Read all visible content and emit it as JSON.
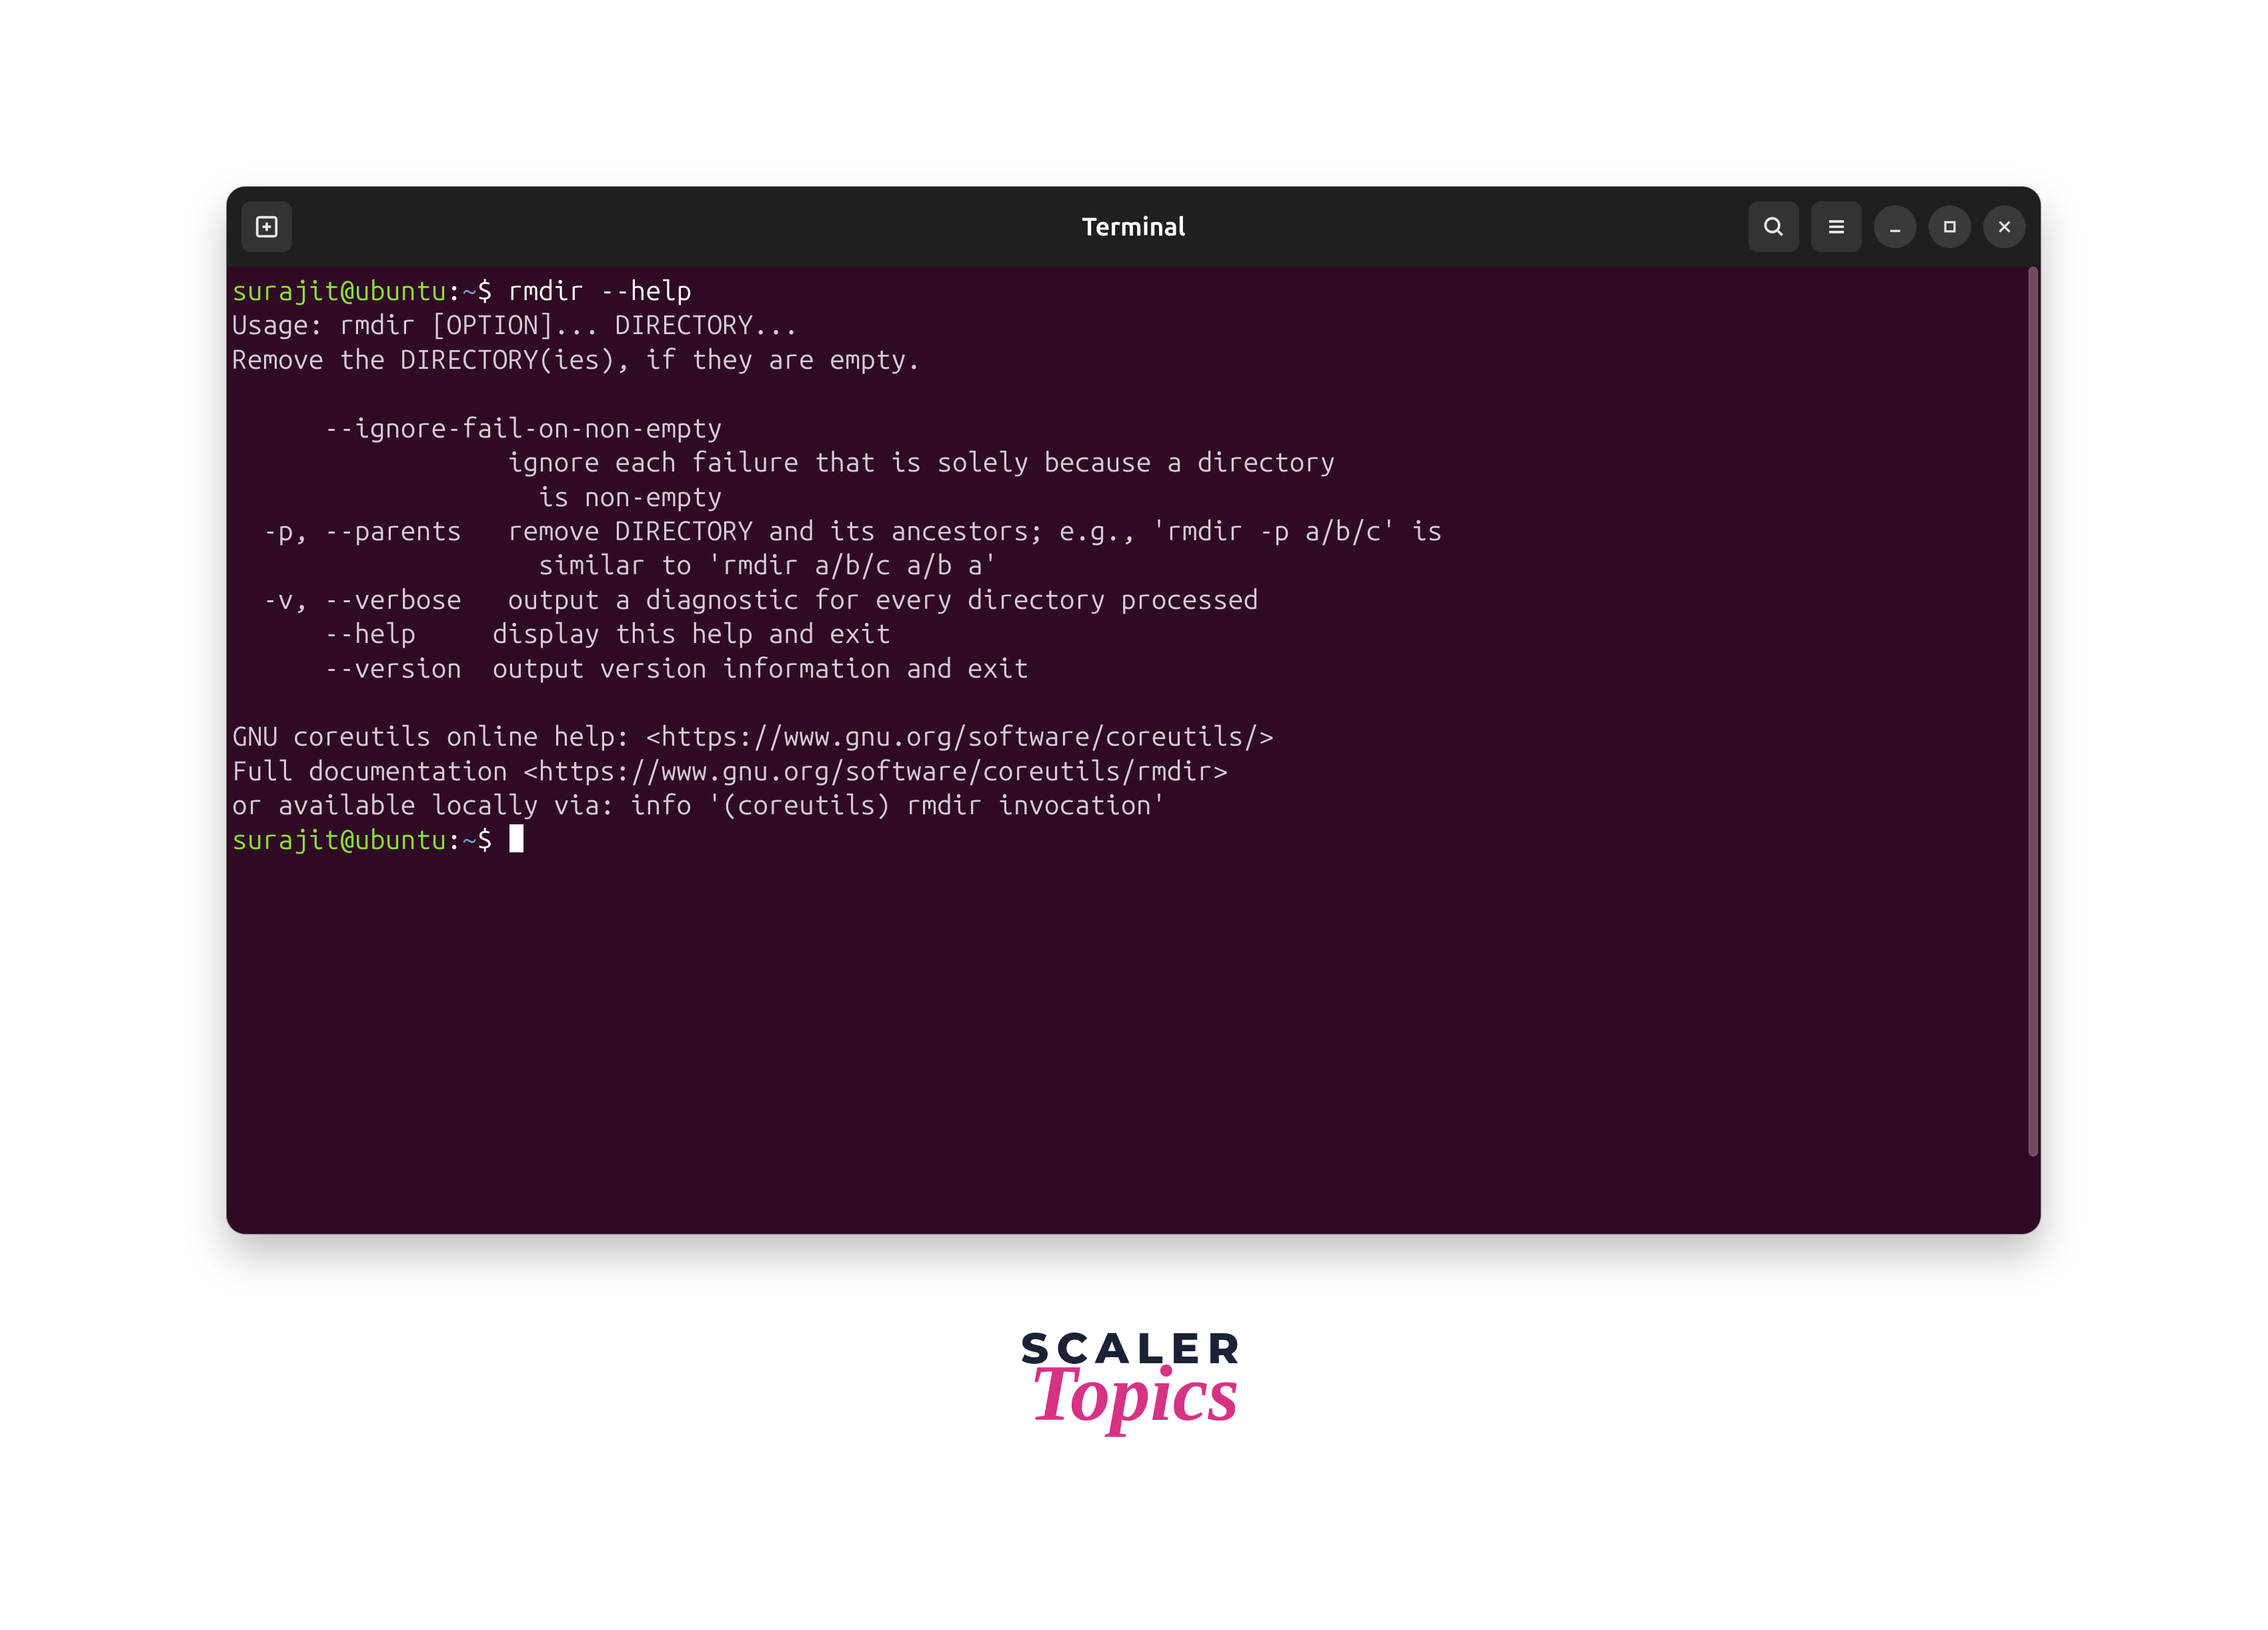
{
  "window": {
    "title": "Terminal"
  },
  "session": {
    "user": "surajit",
    "host": "ubuntu",
    "path": "~",
    "prompt_symbol": "$"
  },
  "command": "rmdir --help",
  "output_lines": [
    "Usage: rmdir [OPTION]... DIRECTORY...",
    "Remove the DIRECTORY(ies), if they are empty.",
    "",
    "      --ignore-fail-on-non-empty",
    "                  ignore each failure that is solely because a directory",
    "                    is non-empty",
    "  -p, --parents   remove DIRECTORY and its ancestors; e.g., 'rmdir -p a/b/c' is",
    "                    similar to 'rmdir a/b/c a/b a'",
    "  -v, --verbose   output a diagnostic for every directory processed",
    "      --help     display this help and exit",
    "      --version  output version information and exit",
    "",
    "GNU coreutils online help: <https://www.gnu.org/software/coreutils/>",
    "Full documentation <https://www.gnu.org/software/coreutils/rmdir>",
    "or available locally via: info '(coreutils) rmdir invocation'"
  ],
  "brand": {
    "top": "SCALER",
    "bottom": "Topics"
  }
}
